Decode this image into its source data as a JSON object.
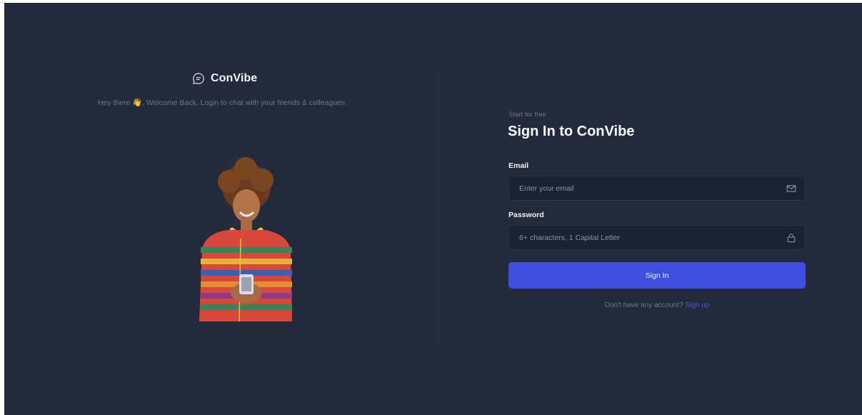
{
  "brand": {
    "name": "ConVibe",
    "icon": "chat-bubble-icon"
  },
  "welcome": {
    "text_before": "Hey there ",
    "emoji": "👋",
    "text_after": ", Welcome Back. Login to chat with your friends & colleagues"
  },
  "illustration": {
    "icon": "person-with-phone-illustration"
  },
  "form": {
    "eyebrow": "Start for free",
    "title": "Sign In to ConVibe",
    "email": {
      "label": "Email",
      "placeholder": "Enter your email",
      "value": "",
      "icon": "mail-icon"
    },
    "password": {
      "label": "Password",
      "placeholder": "6+ characters, 1 Capital Letter",
      "value": "",
      "icon": "lock-icon"
    },
    "submit_label": "Sign In",
    "signup_prompt": "Don't have any account? ",
    "signup_link": "Sign up"
  },
  "colors": {
    "background": "#222a3b",
    "input_background": "#1b2232",
    "accent": "#3e4fdf",
    "link": "#4659e6",
    "muted_text": "#6c7587"
  }
}
